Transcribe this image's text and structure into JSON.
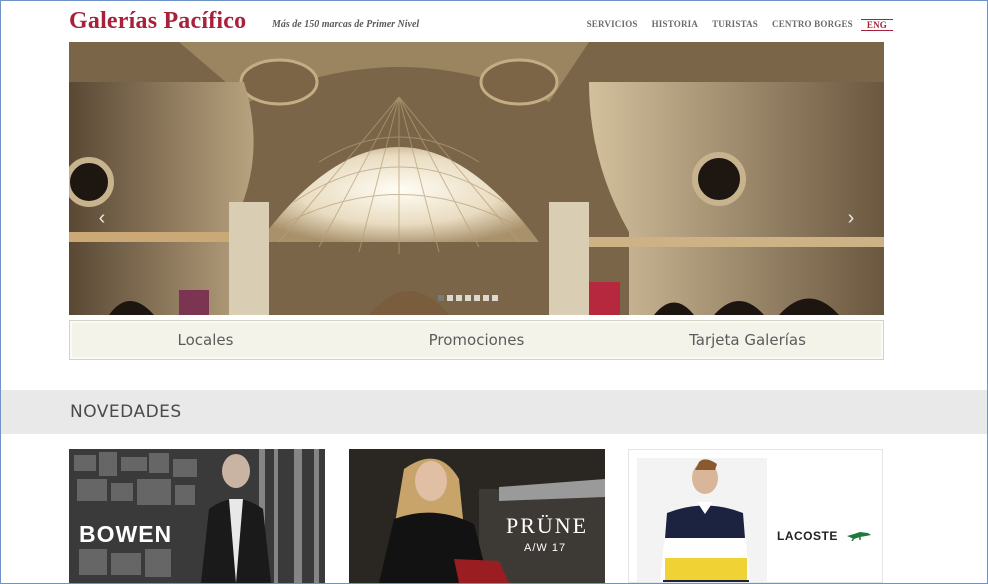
{
  "header": {
    "logo": "Galerías Pacífico",
    "tagline": "Más de 150 marcas de Primer Nivel",
    "nav": [
      {
        "label": "SERVICIOS"
      },
      {
        "label": "HISTORIA"
      },
      {
        "label": "TURISTAS"
      },
      {
        "label": "CENTRO BORGES"
      },
      {
        "label": "ENG"
      }
    ]
  },
  "hero": {
    "prev_icon": "chevron-left-icon",
    "next_icon": "chevron-right-icon",
    "slides_total": 7,
    "active_slide": 1
  },
  "categories": [
    {
      "label": "Locales"
    },
    {
      "label": "Promociones"
    },
    {
      "label": "Tarjeta Galerías"
    }
  ],
  "novedades": {
    "title": "NOVEDADES",
    "cards": [
      {
        "brand": "BOWEN"
      },
      {
        "brand": "PRÜNE",
        "season": "A/W 17"
      },
      {
        "brand": "LACOSTE",
        "icon": "crocodile-icon"
      }
    ]
  },
  "colors": {
    "brand": "#a8203a",
    "nav_text": "#6b6b6b",
    "band_bg": "#e9e9e9",
    "tab_bg": "#f4f3ea",
    "lacoste_green": "#1f7a3c"
  }
}
